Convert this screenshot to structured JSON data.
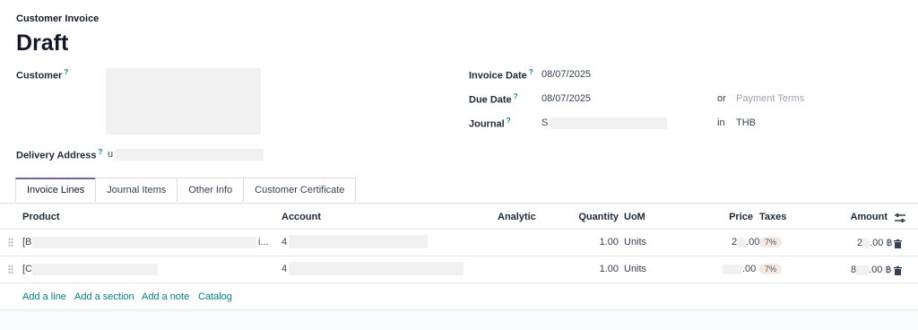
{
  "header": {
    "document_type": "Customer Invoice",
    "status": "Draft"
  },
  "fields": {
    "customer_label": "Customer",
    "delivery_address_label": "Delivery Address",
    "delivery_address_value": "u",
    "invoice_date_label": "Invoice Date",
    "invoice_date_value": "08/07/2025",
    "due_date_label": "Due Date",
    "due_date_value": "08/07/2025",
    "or_text": "or",
    "payment_terms_placeholder": "Payment Terms",
    "journal_label": "Journal",
    "journal_value": "S",
    "in_text": "in",
    "currency": "THB",
    "tooltip_mark": "?"
  },
  "tabs": [
    "Invoice Lines",
    "Journal Items",
    "Other Info",
    "Customer Certificate"
  ],
  "table": {
    "headers": {
      "product": "Product",
      "account": "Account",
      "analytic": "Analytic",
      "quantity": "Quantity",
      "uom": "UoM",
      "price": "Price",
      "taxes": "Taxes",
      "amount": "Amount"
    },
    "rows": [
      {
        "product": "[B",
        "product_tail": "i...",
        "account": "4",
        "quantity": "1.00",
        "uom": "Units",
        "price_a": "2",
        "price_b": ".00",
        "tax": "7%",
        "amount_a": "2",
        "amount_b": ".00 ฿"
      },
      {
        "product": "[C",
        "product_tail": "",
        "account": "4",
        "quantity": "1.00",
        "uom": "Units",
        "price_a": "",
        "price_b": ".00",
        "tax": "7%",
        "amount_a": "8",
        "amount_b": ".00 ฿"
      }
    ]
  },
  "actions": {
    "add_line": "Add a line",
    "add_section": "Add a section",
    "add_note": "Add a note",
    "catalog": "Catalog"
  },
  "icons": {
    "settings": "sliders-icon",
    "delete": "trash-icon",
    "drag": "drag-handle-icon"
  },
  "colors": {
    "accent": "#017e84",
    "active_tab": "#71639e",
    "tax_badge": "#f3e8e3"
  }
}
